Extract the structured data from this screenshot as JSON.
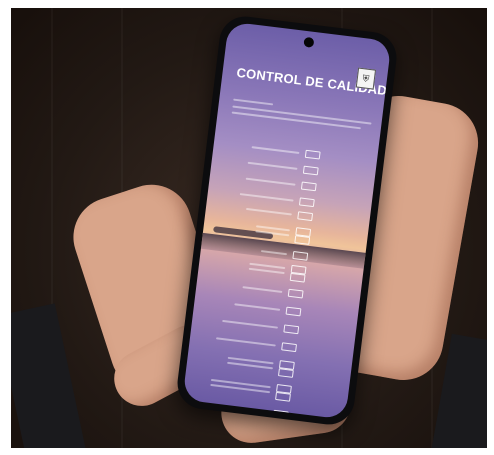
{
  "app": {
    "title": "CONTROL DE CALIDAD",
    "logo_icon": "quality-seal-icon"
  },
  "colors": {
    "screen_top": "#6c5ea8",
    "sunset_glow": "#f0c49a",
    "screen_bottom": "#6a5aa4",
    "background": "#221914"
  }
}
